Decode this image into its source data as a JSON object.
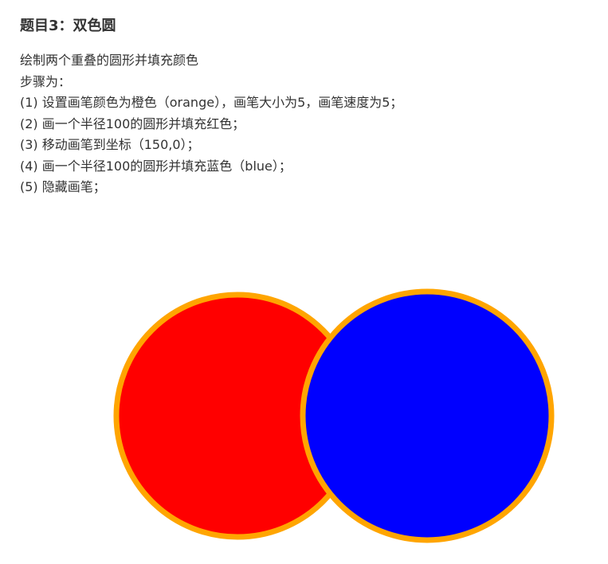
{
  "title": "题目3：双色圆",
  "lines": [
    "绘制两个重叠的圆形并填充颜色",
    "步骤为：",
    "(1) 设置画笔颜色为橙色（orange），画笔大小为5，画笔速度为5；",
    "(2) 画一个半径100的圆形并填充红色；",
    "(3) 移动画笔到坐标（150,0）；",
    "(4) 画一个半径100的圆形并填充蓝色（blue）；",
    "(5) 隐藏画笔；"
  ],
  "drawing": {
    "pen_color": "#ffa500",
    "circles": [
      {
        "name": "red-circle",
        "fill": "#ff0000",
        "radius": 100
      },
      {
        "name": "blue-circle",
        "fill": "#0000ff",
        "radius": 100
      }
    ]
  }
}
